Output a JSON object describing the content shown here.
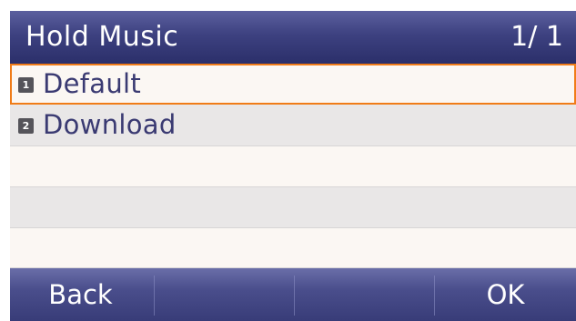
{
  "header": {
    "title": "Hold Music",
    "page": "1/ 1"
  },
  "menu": {
    "items": [
      {
        "number": "1",
        "label": "Default",
        "selected": true
      },
      {
        "number": "2",
        "label": "Download",
        "selected": false
      }
    ]
  },
  "softkeys": [
    "Back",
    "",
    "",
    "OK"
  ],
  "colors": {
    "header": "#3d4180",
    "selection_border": "#f07c18",
    "label_text": "#3a3a72",
    "row_light": "#fbf7f3",
    "row_dark": "#e9e7e7"
  }
}
